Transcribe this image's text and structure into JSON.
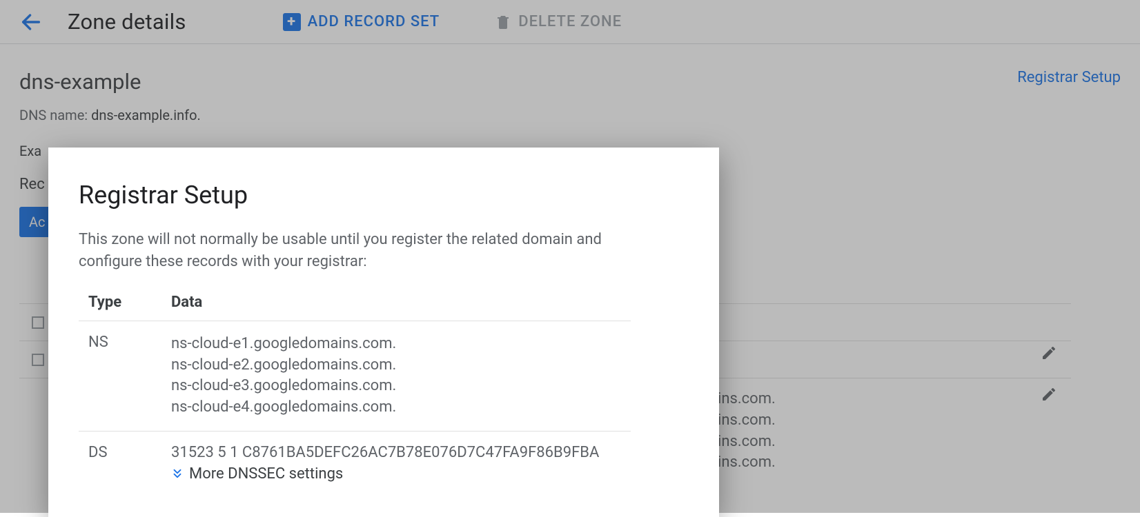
{
  "header": {
    "title": "Zone details",
    "add_record_label": "ADD RECORD SET",
    "delete_zone_label": "DELETE ZONE"
  },
  "zone": {
    "name": "dns-example",
    "dns_name_label": "DNS name:",
    "dns_name_value": "dns-example.info."
  },
  "links": {
    "registrar_setup": "Registrar Setup"
  },
  "dialog": {
    "title": "Registrar Setup",
    "description": "This zone will not normally be usable until you register the related domain and configure these records with your registrar:",
    "col_type": "Type",
    "col_data": "Data",
    "rows": {
      "ns": {
        "type": "NS",
        "values": [
          "ns-cloud-e1.googledomains.com.",
          "ns-cloud-e2.googledomains.com.",
          "ns-cloud-e3.googledomains.com.",
          "ns-cloud-e4.googledomains.com."
        ]
      },
      "ds": {
        "type": "DS",
        "value": "31523 5 1 C8761BA5DEFC26AC7B78E076D7C47FA9F86B9FBA",
        "more": "More DNSSEC settings"
      }
    }
  },
  "background": {
    "example_partial": "Exa",
    "records_partial": "Rec",
    "add_btn_partial": "Ac",
    "domain_fragments": [
      "ins.com.",
      "ins.com.",
      "ins.com.",
      "ins.com."
    ]
  }
}
